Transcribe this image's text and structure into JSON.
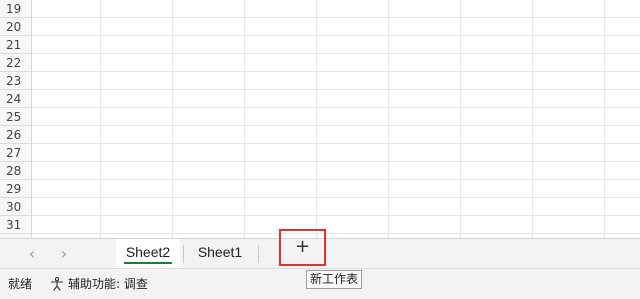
{
  "grid": {
    "rows": [
      "19",
      "20",
      "21",
      "22",
      "23",
      "24",
      "25",
      "26",
      "27",
      "28",
      "29",
      "30",
      "31"
    ]
  },
  "tabs": {
    "prev_label": "‹",
    "next_label": "›",
    "sheets": [
      {
        "label": "Sheet2",
        "active": true
      },
      {
        "label": "Sheet1",
        "active": false
      }
    ],
    "add_label": "+",
    "add_tooltip": "新工作表"
  },
  "status": {
    "ready": "就绪",
    "accessibility": "辅助功能: 调查"
  },
  "colors": {
    "active_tab_underline": "#1f7a3f",
    "highlight_box": "#e0322f"
  }
}
